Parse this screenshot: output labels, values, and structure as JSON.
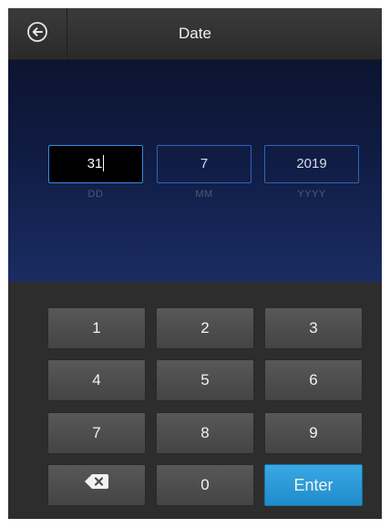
{
  "header": {
    "title": "Date",
    "back_icon": "back-arrow-icon"
  },
  "date": {
    "day": {
      "value": "31",
      "label": "DD",
      "active": true
    },
    "month": {
      "value": "7",
      "label": "MM"
    },
    "year": {
      "value": "2019",
      "label": "YYYY"
    }
  },
  "keypad": {
    "keys": [
      "1",
      "2",
      "3",
      "4",
      "5",
      "6",
      "7",
      "8",
      "9"
    ],
    "backspace_icon": "backspace-icon",
    "zero": "0",
    "enter": "Enter"
  },
  "colors": {
    "accent": "#2a96d6",
    "field_border": "#2e64b8"
  }
}
